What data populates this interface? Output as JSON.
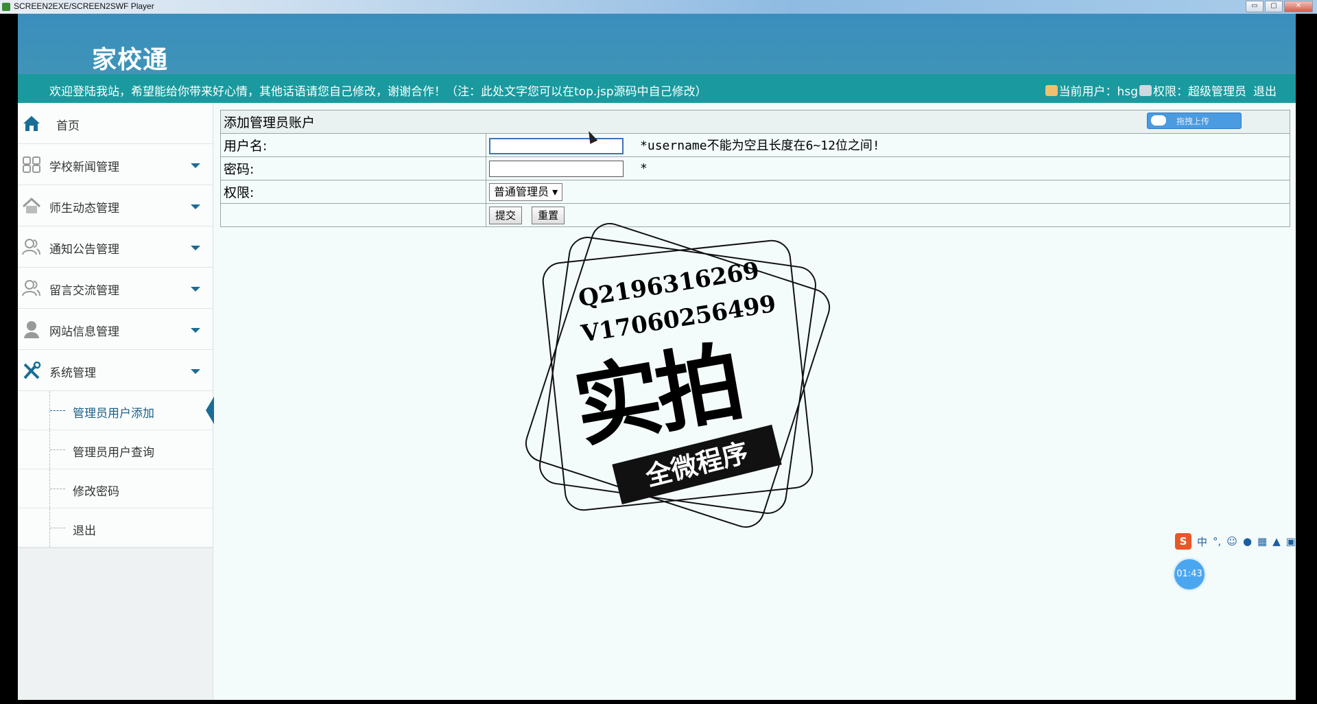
{
  "window": {
    "title": "SCREEN2EXE/SCREEN2SWF Player",
    "minimize_glyph": "▭",
    "maximize_glyph": "▢",
    "close_glyph": "✕"
  },
  "header": {
    "brand": "家校通",
    "notice": "欢迎登陆我站，希望能给你带来好心情，其他话语请您自己修改，谢谢合作！（注：此处文字您可以在top.jsp源码中自己修改）",
    "current_user": "当前用户：hsg",
    "permission": "权限：超级管理员",
    "logout": "退出"
  },
  "upload_widget": {
    "label": "拖拽上传"
  },
  "sidebar": {
    "items": [
      {
        "label": "首页",
        "icon": "home-icon"
      },
      {
        "label": "学校新闻管理",
        "icon": "grid-icon"
      },
      {
        "label": "师生动态管理",
        "icon": "house-icon"
      },
      {
        "label": "通知公告管理",
        "icon": "users-icon"
      },
      {
        "label": "留言交流管理",
        "icon": "users-icon"
      },
      {
        "label": "网站信息管理",
        "icon": "person-icon"
      },
      {
        "label": "系统管理",
        "icon": "tools-icon"
      }
    ],
    "sub_items": [
      {
        "label": "管理员用户添加"
      },
      {
        "label": "管理员用户查询"
      },
      {
        "label": "修改密码"
      },
      {
        "label": "退出"
      }
    ]
  },
  "form": {
    "caption": "添加管理员账户",
    "username_label": "用户名:",
    "username_value": "",
    "username_hint": "*username不能为空且长度在6~12位之间!",
    "password_label": "密码:",
    "password_value": "",
    "password_hint": "*",
    "permission_label": "权限:",
    "permission_selected": "普通管理员",
    "submit_label": "提交",
    "reset_label": "重置"
  },
  "watermark": {
    "line1": "Q2196316269",
    "line2": "V17060256499",
    "big": "实拍",
    "band": "全微程序"
  },
  "overlay": {
    "ime_logo": "S",
    "ime_mode": "中",
    "ime_punct": "°,",
    "ime_face": "☺",
    "timer": "01:43"
  }
}
